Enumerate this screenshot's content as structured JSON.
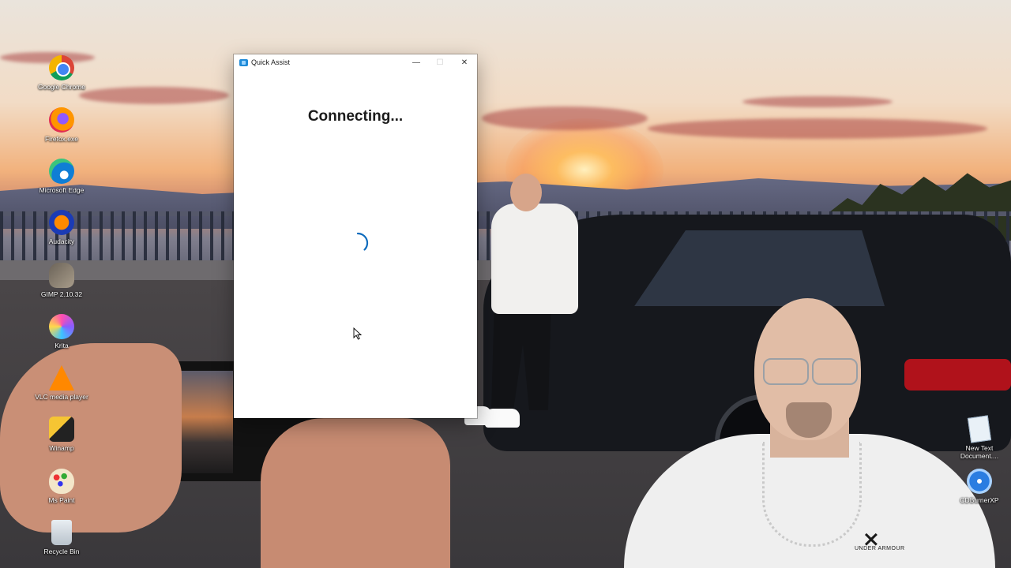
{
  "window": {
    "title": "Quick Assist",
    "status_text": "Connecting...",
    "controls": {
      "minimize": "—",
      "maximize": "☐",
      "close": "✕"
    }
  },
  "desktop_icons": [
    {
      "label": "Google Chrome",
      "icon": "chrome-icon"
    },
    {
      "label": "Firefox.exe",
      "icon": "firefox-icon"
    },
    {
      "label": "Microsoft Edge",
      "icon": "edge-icon"
    },
    {
      "label": "Audacity",
      "icon": "audacity-icon"
    },
    {
      "label": "GIMP 2.10.32",
      "icon": "gimp-icon"
    },
    {
      "label": "Krita",
      "icon": "krita-icon"
    },
    {
      "label": "VLC media player",
      "icon": "vlc-icon"
    },
    {
      "label": "Winamp",
      "icon": "winamp-icon"
    },
    {
      "label": "Ms Paint",
      "icon": "paint-icon"
    },
    {
      "label": "Recycle Bin",
      "icon": "recycle-bin-icon"
    },
    {
      "label": "New Text Document....",
      "icon": "text-document-icon"
    },
    {
      "label": "CDBurnerXP",
      "icon": "cdburnerxp-icon"
    }
  ],
  "webcam_overlay": {
    "shirt_logo": "UNDER ARMOUR"
  },
  "colors": {
    "spinner": "#0f6cbd",
    "window_bg": "#ffffff",
    "accent": "#1f8bd8"
  }
}
